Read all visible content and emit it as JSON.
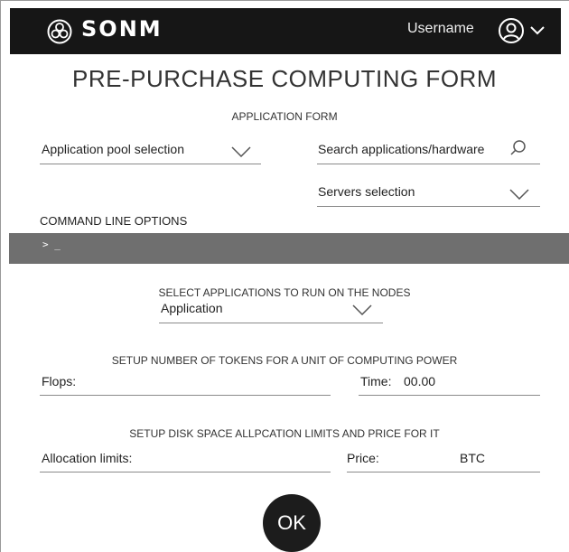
{
  "header": {
    "brand": "SONM",
    "username": "Username",
    "logo_icon": "sonm-logo-icon",
    "user_icon": "user-circle-icon",
    "menu_icon": "chevron-down-icon"
  },
  "form": {
    "title": "PRE-PURCHASE COMPUTING FORM",
    "subtitle": "APPLICATION FORM",
    "application_pool": {
      "value": "Application pool selection",
      "icon": "chevron-down-icon"
    },
    "search": {
      "placeholder": "Search applications/hardware",
      "icon": "search-icon"
    },
    "servers": {
      "value": "Servers selection",
      "icon": "chevron-down-icon"
    }
  },
  "command_line": {
    "label": "COMMAND LINE OPTIONS",
    "prompt": "> _"
  },
  "applications": {
    "heading": "SELECT APPLICATIONS TO RUN ON THE NODES",
    "select": {
      "value": "Application",
      "icon": "chevron-down-icon"
    }
  },
  "tokens": {
    "heading": "SETUP NUMBER OF TOKENS FOR A UNIT OF COMPUTING POWER",
    "flops_label": "Flops:",
    "time_label": "Time:",
    "time_value": "00.00"
  },
  "disk": {
    "heading": "SETUP DISK SPACE ALLPCATION LIMITS AND PRICE FOR IT",
    "allocation_label": "Allocation limits:",
    "price_label": "Price:",
    "price_currency": "BTC"
  },
  "submit": {
    "label": "OK"
  },
  "colors": {
    "topbar": "#161616",
    "console": "#6f6f6f",
    "button": "#1c1c1c",
    "underline": "#8a8a8a"
  }
}
